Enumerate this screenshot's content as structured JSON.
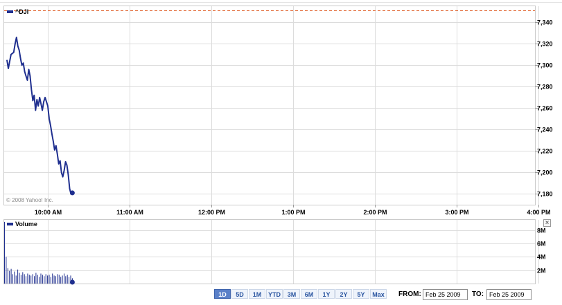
{
  "copyright": "© 2008 Yahoo! Inc.",
  "volume_close_label": "×",
  "range_buttons": [
    "1D",
    "5D",
    "1M",
    "YTD",
    "3M",
    "6M",
    "1Y",
    "2Y",
    "5Y",
    "Max"
  ],
  "active_range": "1D",
  "from_label": "FROM:",
  "from_value": "Feb 25 2009",
  "to_label": "TO:",
  "to_value": "Feb 25 2009",
  "colors": {
    "line": "#1f2f8f",
    "prev_close": "#e0602a",
    "volume": "#1f2f8f",
    "grid": "#dcdcdc"
  },
  "chart_data": [
    {
      "type": "line",
      "title": "^DJI",
      "legend": "^DJI",
      "x_ticks": [
        "10:00 AM",
        "11:00 AM",
        "12:00 PM",
        "1:00 PM",
        "2:00 PM",
        "3:00 PM",
        "4:00 PM"
      ],
      "y_ticks": [
        "7,180",
        "7,200",
        "7,220",
        "7,240",
        "7,260",
        "7,280",
        "7,300",
        "7,320",
        "7,340"
      ],
      "ylim": [
        7170,
        7355
      ],
      "xlim": [
        "9:30 AM",
        "4:00 PM"
      ],
      "previous_close": 7351,
      "series": [
        {
          "name": "^DJI",
          "x": [
            "9:30",
            "9:31",
            "9:33",
            "9:35",
            "9:36",
            "9:37",
            "9:38",
            "9:39",
            "9:40",
            "9:41",
            "9:42",
            "9:43",
            "9:44",
            "9:45",
            "9:46",
            "9:47",
            "9:48",
            "9:49",
            "9:50",
            "9:51",
            "9:52",
            "9:53",
            "9:54",
            "9:55",
            "9:56",
            "9:57",
            "9:58",
            "9:59",
            "10:00",
            "10:01",
            "10:02",
            "10:03",
            "10:04",
            "10:05",
            "10:06",
            "10:07",
            "10:08",
            "10:09",
            "10:10",
            "10:11",
            "10:12",
            "10:13",
            "10:14",
            "10:15",
            "10:16",
            "10:17",
            "10:18"
          ],
          "values": [
            7305,
            7297,
            7310,
            7312,
            7320,
            7326,
            7318,
            7314,
            7306,
            7300,
            7302,
            7294,
            7290,
            7286,
            7296,
            7290,
            7277,
            7267,
            7272,
            7258,
            7268,
            7262,
            7270,
            7264,
            7258,
            7266,
            7270,
            7266,
            7262,
            7250,
            7244,
            7236,
            7229,
            7221,
            7225,
            7217,
            7208,
            7211,
            7200,
            7196,
            7202,
            7210,
            7207,
            7198,
            7185,
            7180,
            7181
          ]
        }
      ],
      "last_value": 7181,
      "grid": true
    },
    {
      "type": "bar",
      "title": "Volume",
      "legend": "Volume",
      "y_ticks": [
        "2M",
        "4M",
        "6M",
        "8M"
      ],
      "ylim": [
        0,
        9500000
      ],
      "x_ticks": [],
      "series": [
        {
          "name": "Volume",
          "values": [
            9200000,
            4000000,
            2300000,
            1900000,
            2200000,
            1400000,
            1800000,
            1200000,
            2100000,
            1600000,
            1300000,
            1700000,
            1400000,
            1100000,
            1500000,
            1300000,
            1200000,
            1400000,
            1100000,
            1600000,
            1300000,
            1000000,
            1500000,
            1300000,
            1100000,
            1400000,
            1200000,
            1300000,
            1000000,
            1500000,
            1200000,
            1100000,
            1400000,
            1300000,
            1000000,
            1200000,
            1500000,
            1100000,
            1300000,
            1000000,
            1200000,
            800000
          ]
        }
      ],
      "grid": true
    }
  ]
}
